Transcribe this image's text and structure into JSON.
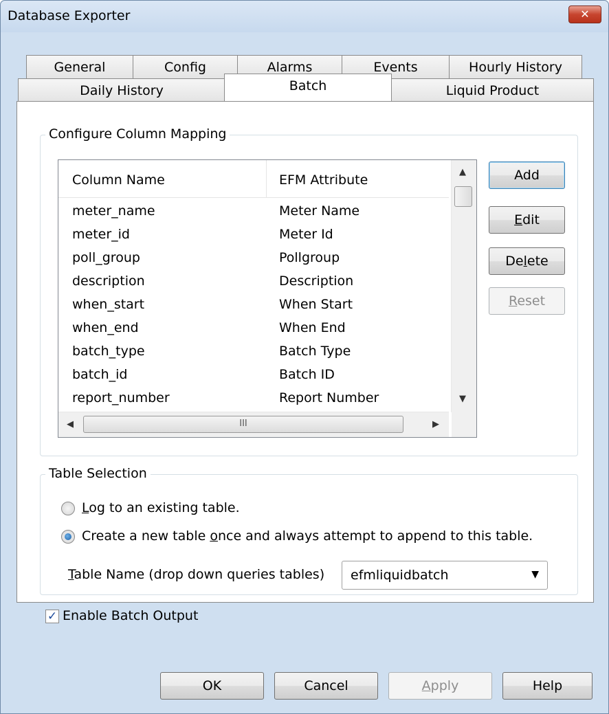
{
  "window": {
    "title": "Database Exporter",
    "close_glyph": "✕"
  },
  "tabs": {
    "row1": [
      "General",
      "Config",
      "Alarms",
      "Events",
      "Hourly History"
    ],
    "row2": [
      "Daily History",
      "Batch",
      "Liquid Product"
    ],
    "active": "Batch"
  },
  "column_mapping": {
    "group_label": "Configure Column Mapping",
    "headers": {
      "column_name": "Column Name",
      "efm_attribute": "EFM Attribute"
    },
    "rows": [
      {
        "column": "meter_name",
        "attribute": "Meter Name"
      },
      {
        "column": "meter_id",
        "attribute": "Meter Id"
      },
      {
        "column": "poll_group",
        "attribute": "Pollgroup"
      },
      {
        "column": "description",
        "attribute": "Description"
      },
      {
        "column": "when_start",
        "attribute": "When Start"
      },
      {
        "column": "when_end",
        "attribute": "When End"
      },
      {
        "column": "batch_type",
        "attribute": "Batch Type"
      },
      {
        "column": "batch_id",
        "attribute": "Batch ID"
      },
      {
        "column": "report_number",
        "attribute": "Report Number"
      }
    ],
    "buttons": {
      "add": "Add",
      "edit": {
        "mnemonic": "E",
        "rest": "dit"
      },
      "delete": {
        "pre": "De",
        "mnemonic": "l",
        "rest": "ete"
      },
      "reset": {
        "mnemonic": "R",
        "rest": "eset"
      }
    },
    "scroll": {
      "up": "▲",
      "down": "▼",
      "left": "◀",
      "right": "▶",
      "grip": "III"
    }
  },
  "table_selection": {
    "group_label": "Table Selection",
    "option_existing": {
      "mnemonic": "L",
      "rest": "og to an existing table.",
      "checked": false
    },
    "option_new": {
      "pre": "Create a new table ",
      "mnemonic": "o",
      "rest": "nce and always attempt to append to this table.",
      "checked": true
    },
    "table_name_label": {
      "mnemonic": "T",
      "rest": "able Name (drop down queries tables)"
    },
    "table_name_value": "efmliquidbatch",
    "dropdown_arrow": "▼"
  },
  "enable_batch_output": {
    "label": "Enable Batch Output",
    "checked": true,
    "check_glyph": "✓"
  },
  "footer": {
    "ok": "OK",
    "cancel": "Cancel",
    "apply": {
      "mnemonic": "A",
      "rest": "pply"
    },
    "help": "Help"
  }
}
